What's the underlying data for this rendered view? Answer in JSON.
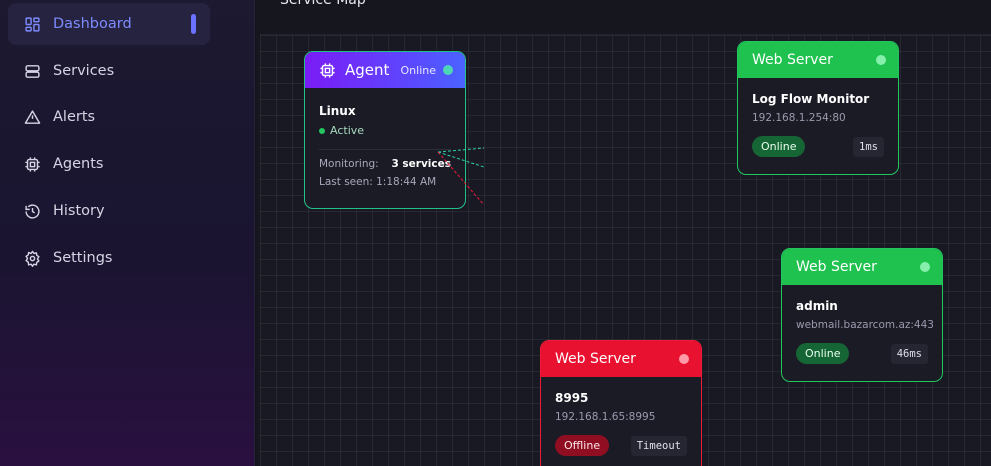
{
  "sidebar": {
    "items": [
      {
        "label": "Dashboard",
        "icon": "dashboard-icon",
        "active": true
      },
      {
        "label": "Services",
        "icon": "server-icon"
      },
      {
        "label": "Alerts",
        "icon": "alert-triangle-icon"
      },
      {
        "label": "Agents",
        "icon": "cpu-icon"
      },
      {
        "label": "History",
        "icon": "history-icon"
      },
      {
        "label": "Settings",
        "icon": "gear-icon"
      }
    ]
  },
  "main": {
    "title": "Service Map",
    "agent": {
      "title": "Agent",
      "status": "Online",
      "os": "Linux",
      "state": "Active",
      "monitoring_label": "Monitoring:",
      "monitoring_value": "3 services",
      "last_seen": "Last seen: 1:18:44 AM"
    },
    "services": [
      {
        "title": "Web Server",
        "name": "Log Flow Monitor",
        "address": "192.168.1.254:80",
        "status": "Online",
        "latency": "1ms"
      },
      {
        "title": "Web Server",
        "name": "admin",
        "address": "webmail.bazarcom.az:443",
        "status": "Online",
        "latency": "46ms"
      },
      {
        "title": "Web Server",
        "name": "8995",
        "address": "192.168.1.65:8995",
        "status": "Offline",
        "latency": "Timeout"
      }
    ]
  },
  "colors": {
    "accent": "#6b70ff",
    "online": "#22c55e",
    "offline": "#ef1a3a",
    "agent_gradient_start": "#7a1cf5"
  }
}
